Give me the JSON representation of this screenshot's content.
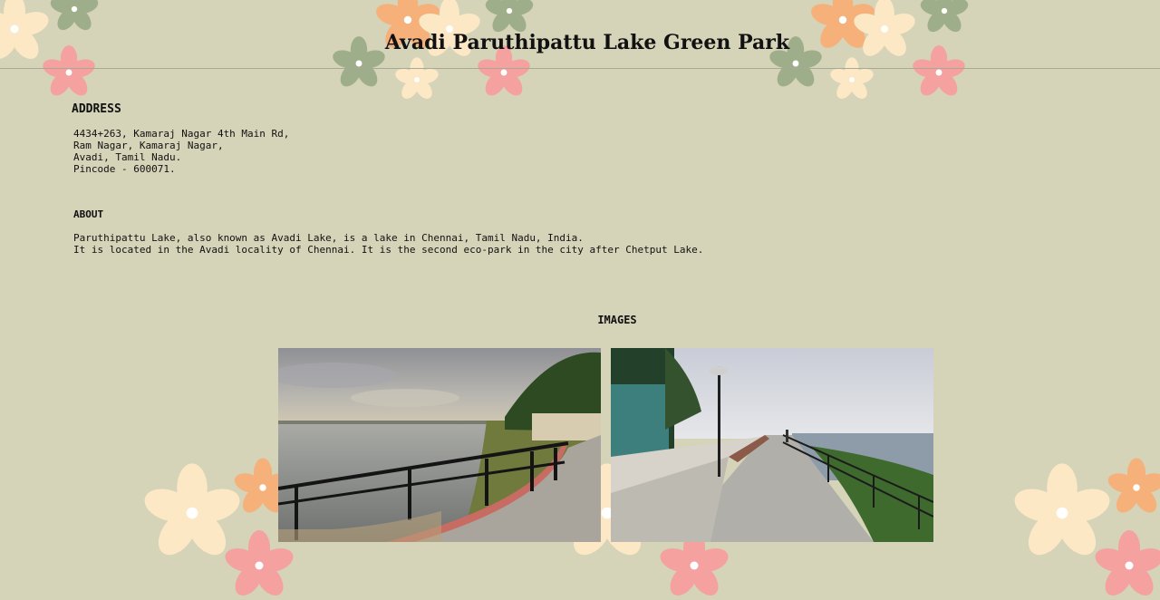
{
  "page": {
    "corner_mark": ">",
    "title": "Avadi Paruthipattu Lake Green Park"
  },
  "address": {
    "heading": "ADDRESS",
    "lines": [
      "4434+263, Kamaraj Nagar 4th Main Rd,",
      "Ram Nagar, Kamaraj Nagar,",
      "Avadi, Tamil Nadu.",
      "Pincode - 600071."
    ]
  },
  "about": {
    "heading": "ABOUT",
    "lines": [
      "Paruthipattu Lake, also known as Avadi Lake, is a lake in Chennai, Tamil Nadu, India.",
      "It is located in the Avadi locality of Chennai. It is the second eco-park in the city after Chetput Lake."
    ]
  },
  "images": {
    "heading": "IMAGES",
    "photos": [
      "lake-railing-walkway-photo",
      "lakeside-promenade-photo"
    ]
  },
  "colors": {
    "background": "#d5d3b8",
    "flower_cream": "#fde8c6",
    "flower_orange": "#f6b07a",
    "flower_pink": "#f4a1a0",
    "flower_green": "#9fae8a"
  }
}
